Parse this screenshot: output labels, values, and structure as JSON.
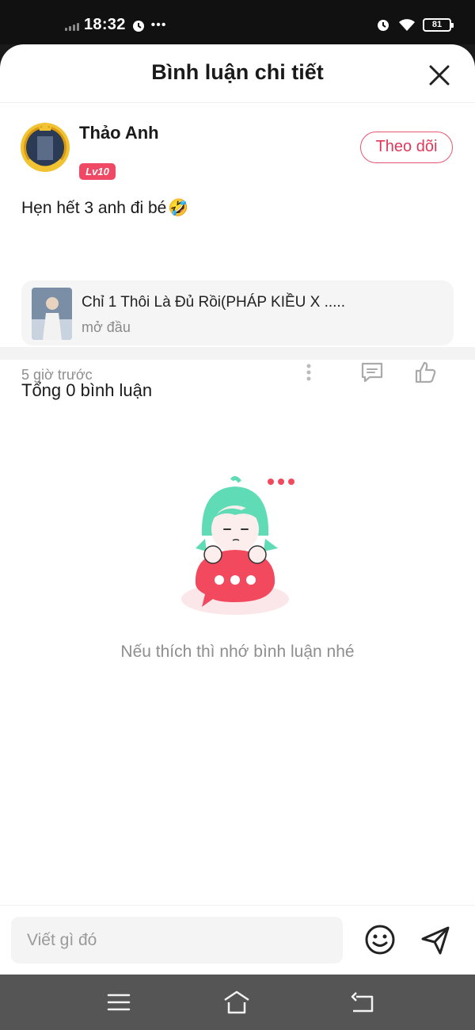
{
  "status_bar": {
    "time": "18:32",
    "more": "•••",
    "battery": "81"
  },
  "header": {
    "title": "Bình luận chi tiết"
  },
  "post": {
    "user_name": "Thảo Anh",
    "level": "Lv10",
    "follow_label": "Theo dõi",
    "text": "Hẹn hết 3 anh đi bé",
    "emoji": "🤣",
    "song": {
      "title": "Chỉ 1 Thôi Là Đủ Rồi(PHÁP KIỀU X .....",
      "subtitle": "mở đầu"
    },
    "time": "5 giờ trước"
  },
  "comments": {
    "total_label": "Tổng 0 bình luận",
    "empty_text": "Nếu thích thì nhớ bình luận nhé"
  },
  "input": {
    "placeholder": "Viết gì đó"
  },
  "colors": {
    "accent": "#ef4966",
    "mint": "#5fdcb5",
    "bubble": "#f2495e"
  },
  "icons": [
    "signal-icon",
    "alarm-icon",
    "wifi-icon",
    "battery-icon",
    "close-icon",
    "more-icon",
    "comment-icon",
    "like-icon",
    "emoji-icon",
    "send-icon",
    "menu-icon",
    "home-icon",
    "back-icon"
  ]
}
